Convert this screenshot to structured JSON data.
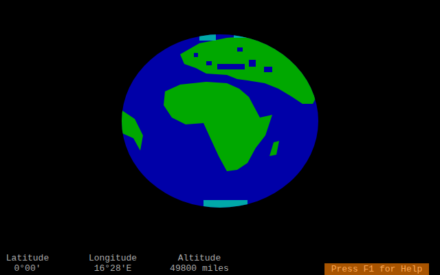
{
  "status_bar": {
    "fields": [
      {
        "label": "Latitude",
        "value": "0°00'"
      },
      {
        "label": "Longitude",
        "value": "16°28'E"
      },
      {
        "label": "Altitude",
        "value": "49800 miles"
      }
    ]
  },
  "help_button": {
    "label": "Press F1 for Help"
  }
}
